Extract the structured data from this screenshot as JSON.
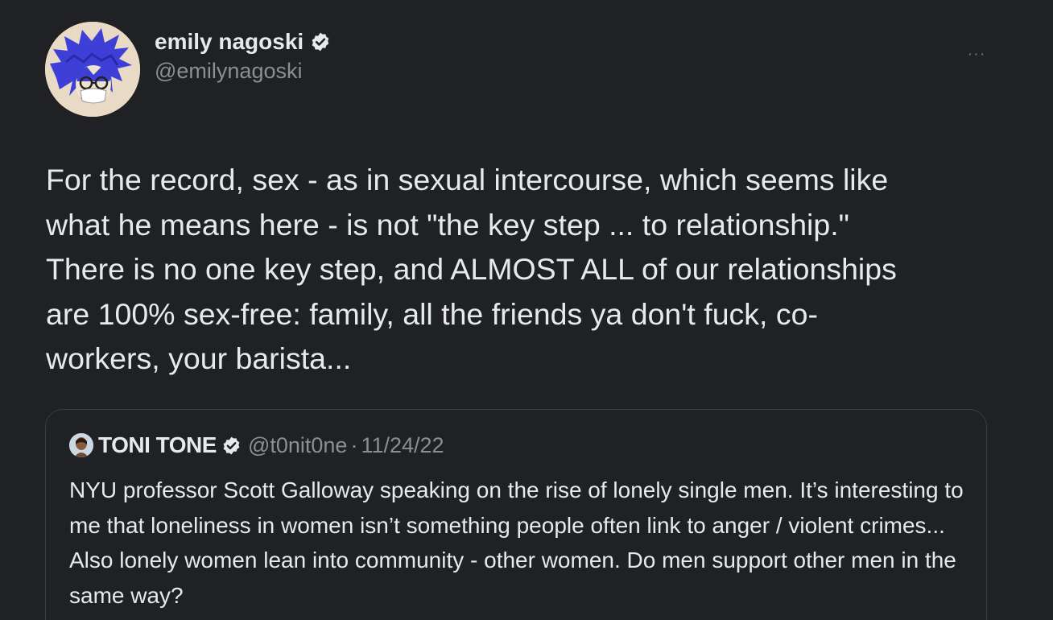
{
  "tweet": {
    "author": {
      "display_name": "emily nagoski",
      "handle": "@emilynagoski",
      "verified_icon": "verified-badge-icon",
      "avatar": "avatar-illustration"
    },
    "more_icon": "more-options-icon",
    "more_label": "···",
    "text": "For the record, sex - as in sexual intercourse, which seems like\nwhat he means here - is not \"the key step ... to relationship.\"\nThere is no one key step, and ALMOST ALL of our relationships\nare 100% sex-free: family, all the friends ya don't fuck, co-\nworkers, your barista..."
  },
  "quote": {
    "author": {
      "display_name": "TONI TONE",
      "handle": "@t0nit0ne",
      "verified_icon": "verified-badge-icon",
      "avatar": "avatar-photo"
    },
    "separator": "·",
    "date": "11/24/22",
    "text": "NYU professor Scott Galloway speaking on the rise of lonely single men. It’s interesting to me that loneliness in women isn’t something people often link to anger / violent crimes... Also lonely women lean into community - other women. Do men support other men in the same way?"
  },
  "colors": {
    "background": "#202124",
    "primary_text": "#e7e9ea",
    "secondary_text": "#8b8f94",
    "card_border": "#3a3d42"
  }
}
